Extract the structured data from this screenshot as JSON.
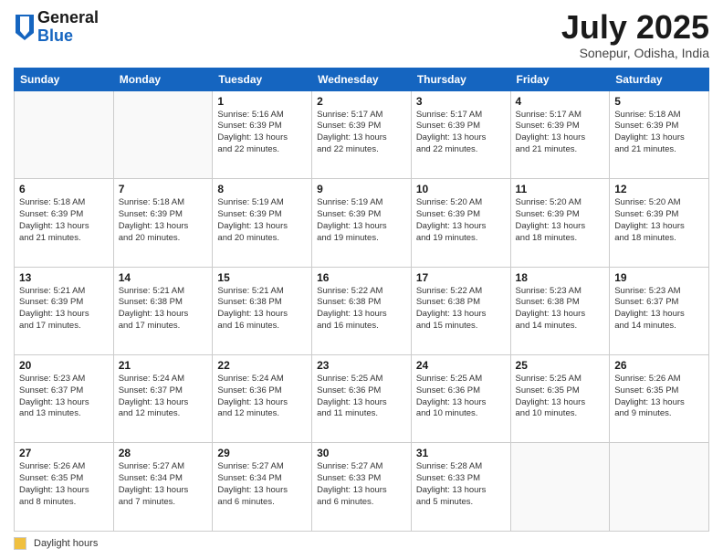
{
  "header": {
    "logo_general": "General",
    "logo_blue": "Blue",
    "month_title": "July 2025",
    "location": "Sonepur, Odisha, India"
  },
  "footer": {
    "daylight_label": "Daylight hours"
  },
  "weekdays": [
    "Sunday",
    "Monday",
    "Tuesday",
    "Wednesday",
    "Thursday",
    "Friday",
    "Saturday"
  ],
  "weeks": [
    [
      {
        "day": "",
        "info": ""
      },
      {
        "day": "",
        "info": ""
      },
      {
        "day": "1",
        "info": "Sunrise: 5:16 AM\nSunset: 6:39 PM\nDaylight: 13 hours\nand 22 minutes."
      },
      {
        "day": "2",
        "info": "Sunrise: 5:17 AM\nSunset: 6:39 PM\nDaylight: 13 hours\nand 22 minutes."
      },
      {
        "day": "3",
        "info": "Sunrise: 5:17 AM\nSunset: 6:39 PM\nDaylight: 13 hours\nand 22 minutes."
      },
      {
        "day": "4",
        "info": "Sunrise: 5:17 AM\nSunset: 6:39 PM\nDaylight: 13 hours\nand 21 minutes."
      },
      {
        "day": "5",
        "info": "Sunrise: 5:18 AM\nSunset: 6:39 PM\nDaylight: 13 hours\nand 21 minutes."
      }
    ],
    [
      {
        "day": "6",
        "info": "Sunrise: 5:18 AM\nSunset: 6:39 PM\nDaylight: 13 hours\nand 21 minutes."
      },
      {
        "day": "7",
        "info": "Sunrise: 5:18 AM\nSunset: 6:39 PM\nDaylight: 13 hours\nand 20 minutes."
      },
      {
        "day": "8",
        "info": "Sunrise: 5:19 AM\nSunset: 6:39 PM\nDaylight: 13 hours\nand 20 minutes."
      },
      {
        "day": "9",
        "info": "Sunrise: 5:19 AM\nSunset: 6:39 PM\nDaylight: 13 hours\nand 19 minutes."
      },
      {
        "day": "10",
        "info": "Sunrise: 5:20 AM\nSunset: 6:39 PM\nDaylight: 13 hours\nand 19 minutes."
      },
      {
        "day": "11",
        "info": "Sunrise: 5:20 AM\nSunset: 6:39 PM\nDaylight: 13 hours\nand 18 minutes."
      },
      {
        "day": "12",
        "info": "Sunrise: 5:20 AM\nSunset: 6:39 PM\nDaylight: 13 hours\nand 18 minutes."
      }
    ],
    [
      {
        "day": "13",
        "info": "Sunrise: 5:21 AM\nSunset: 6:39 PM\nDaylight: 13 hours\nand 17 minutes."
      },
      {
        "day": "14",
        "info": "Sunrise: 5:21 AM\nSunset: 6:38 PM\nDaylight: 13 hours\nand 17 minutes."
      },
      {
        "day": "15",
        "info": "Sunrise: 5:21 AM\nSunset: 6:38 PM\nDaylight: 13 hours\nand 16 minutes."
      },
      {
        "day": "16",
        "info": "Sunrise: 5:22 AM\nSunset: 6:38 PM\nDaylight: 13 hours\nand 16 minutes."
      },
      {
        "day": "17",
        "info": "Sunrise: 5:22 AM\nSunset: 6:38 PM\nDaylight: 13 hours\nand 15 minutes."
      },
      {
        "day": "18",
        "info": "Sunrise: 5:23 AM\nSunset: 6:38 PM\nDaylight: 13 hours\nand 14 minutes."
      },
      {
        "day": "19",
        "info": "Sunrise: 5:23 AM\nSunset: 6:37 PM\nDaylight: 13 hours\nand 14 minutes."
      }
    ],
    [
      {
        "day": "20",
        "info": "Sunrise: 5:23 AM\nSunset: 6:37 PM\nDaylight: 13 hours\nand 13 minutes."
      },
      {
        "day": "21",
        "info": "Sunrise: 5:24 AM\nSunset: 6:37 PM\nDaylight: 13 hours\nand 12 minutes."
      },
      {
        "day": "22",
        "info": "Sunrise: 5:24 AM\nSunset: 6:36 PM\nDaylight: 13 hours\nand 12 minutes."
      },
      {
        "day": "23",
        "info": "Sunrise: 5:25 AM\nSunset: 6:36 PM\nDaylight: 13 hours\nand 11 minutes."
      },
      {
        "day": "24",
        "info": "Sunrise: 5:25 AM\nSunset: 6:36 PM\nDaylight: 13 hours\nand 10 minutes."
      },
      {
        "day": "25",
        "info": "Sunrise: 5:25 AM\nSunset: 6:35 PM\nDaylight: 13 hours\nand 10 minutes."
      },
      {
        "day": "26",
        "info": "Sunrise: 5:26 AM\nSunset: 6:35 PM\nDaylight: 13 hours\nand 9 minutes."
      }
    ],
    [
      {
        "day": "27",
        "info": "Sunrise: 5:26 AM\nSunset: 6:35 PM\nDaylight: 13 hours\nand 8 minutes."
      },
      {
        "day": "28",
        "info": "Sunrise: 5:27 AM\nSunset: 6:34 PM\nDaylight: 13 hours\nand 7 minutes."
      },
      {
        "day": "29",
        "info": "Sunrise: 5:27 AM\nSunset: 6:34 PM\nDaylight: 13 hours\nand 6 minutes."
      },
      {
        "day": "30",
        "info": "Sunrise: 5:27 AM\nSunset: 6:33 PM\nDaylight: 13 hours\nand 6 minutes."
      },
      {
        "day": "31",
        "info": "Sunrise: 5:28 AM\nSunset: 6:33 PM\nDaylight: 13 hours\nand 5 minutes."
      },
      {
        "day": "",
        "info": ""
      },
      {
        "day": "",
        "info": ""
      }
    ]
  ]
}
